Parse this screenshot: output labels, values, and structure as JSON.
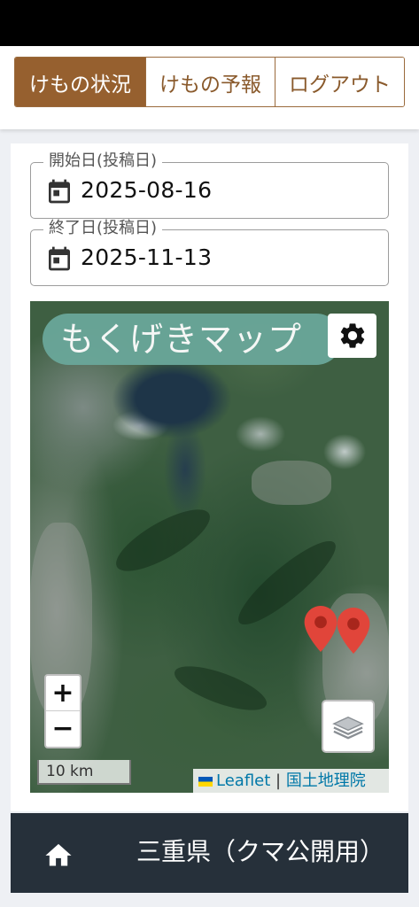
{
  "tabs": [
    {
      "label": "けもの状況",
      "active": true
    },
    {
      "label": "けもの予報",
      "active": false
    },
    {
      "label": "ログアウト",
      "active": false
    }
  ],
  "filters": {
    "start": {
      "label": "開始日(投稿日)",
      "value": "2025-08-16"
    },
    "end": {
      "label": "終了日(投稿日)",
      "value": "2025-11-13"
    }
  },
  "map": {
    "title": "もくげきマップ",
    "zoom_in": "+",
    "zoom_out": "−",
    "scale": "10 km",
    "attribution": {
      "leaflet": "Leaflet",
      "separator": " | ",
      "provider": "国土地理院"
    },
    "marker_color": "#e1453a",
    "icons": [
      "gear-icon",
      "layers-icon",
      "map-marker-icon"
    ]
  },
  "footer": {
    "prefecture": "三重県（クマ公開用）",
    "icon": "home-icon"
  },
  "colors": {
    "accent": "#96602f",
    "title_pill": "#6aa79a",
    "footer_bg": "#26303a"
  }
}
